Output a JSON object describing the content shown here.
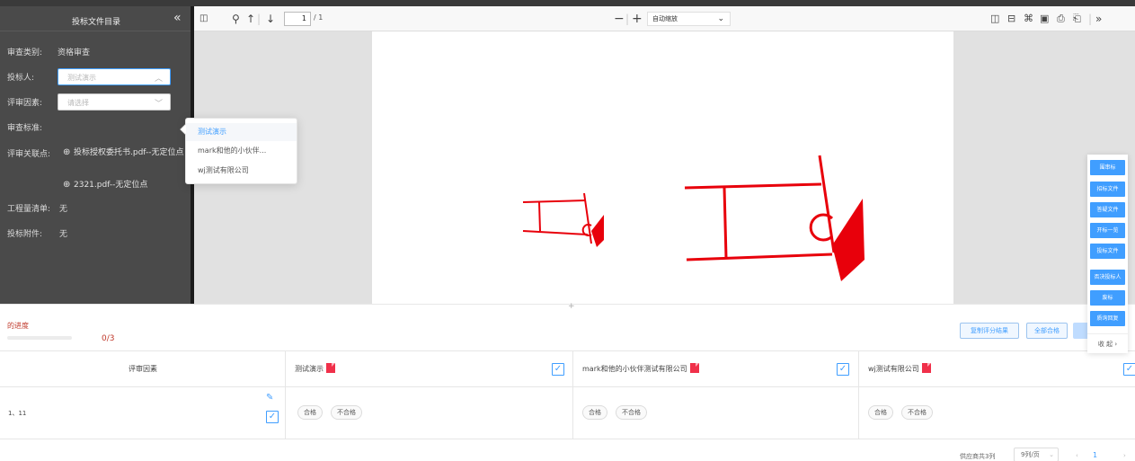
{
  "colors": {
    "accent": "#409eff",
    "danger": "#f0304a",
    "sidebar_bg": "#4a4a4a",
    "progress_text": "#c0392b"
  },
  "sidebar": {
    "title": "投标文件目录",
    "collapse_icon": "double-chevron-left-icon",
    "review_category_label": "审查类别:",
    "review_category_value": "资格审查",
    "bidder_label": "投标人:",
    "bidder_select_value": "测试演示",
    "factor_label": "评审因素:",
    "factor_select_placeholder": "请选择",
    "standard_label": "审查标准:",
    "linked_points_label": "评审关联点:",
    "linked_points": [
      "投标授权委托书.pdf--无定位点",
      "2321.pdf--无定位点"
    ],
    "bill_label": "工程量清单:",
    "bill_value": "无",
    "attachment_label": "投标附件:",
    "attachment_value": "无"
  },
  "bidder_dropdown": {
    "options": [
      "测试演示",
      "mark和他的小伙伴...",
      "wj测试有限公司"
    ],
    "selected_index": 0
  },
  "pdf_toolbar": {
    "page_current": "1",
    "page_total": "/ 1",
    "zoom_value": "自动缩放"
  },
  "progress": {
    "label": "的进度",
    "value": "0/3",
    "fraction": 0.0
  },
  "action_buttons": {
    "copy_label": "复制评分结果",
    "all_pass_label": "全部合格"
  },
  "table": {
    "factor_header": "评审因素",
    "factor_row_label": "1、11",
    "vendors": [
      {
        "name": "测试演示",
        "pass_label": "合格",
        "fail_label": "不合格"
      },
      {
        "name": "mark和他的小伙伴测试有限公司",
        "pass_label": "合格",
        "fail_label": "不合格"
      },
      {
        "name": "wj测试有限公司",
        "pass_label": "合格",
        "fail_label": "不合格"
      }
    ]
  },
  "footer": {
    "total_text": "供应商共3列",
    "page_size": "9列/页",
    "page_number": "1"
  },
  "float_panel": {
    "buttons": [
      "招标文件",
      "答疑文件",
      "开标一览",
      "投标文件",
      "否决投标人",
      "废标",
      "质询回复"
    ],
    "top_button": "围串标",
    "collapse_label": "收 起"
  }
}
